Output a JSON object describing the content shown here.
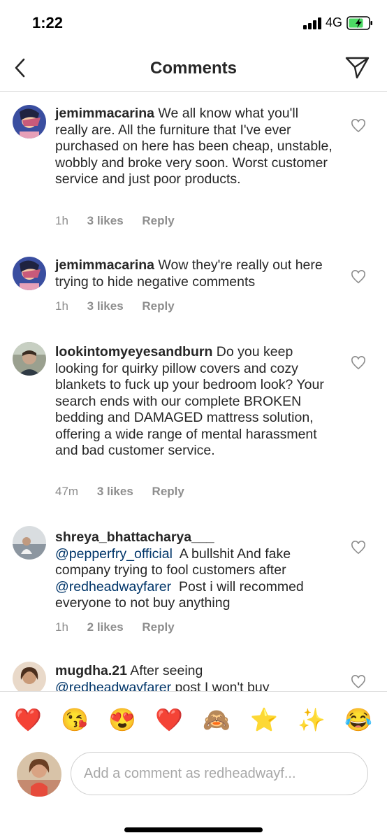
{
  "status_bar": {
    "time": "1:22",
    "network": "4G"
  },
  "header": {
    "title": "Comments"
  },
  "comments": [
    {
      "username": "jemimmacarina",
      "text": "We all know what you'll really are. All the furniture that I've ever purchased on here has been cheap, unstable, wobbly and broke very soon. Worst customer service and just poor products.",
      "time": "1h",
      "likes": "3 likes",
      "reply": "Reply"
    },
    {
      "username": "jemimmacarina",
      "text": "Wow they're really out here trying to hide negative comments",
      "time": "1h",
      "likes": "3 likes",
      "reply": "Reply"
    },
    {
      "username": "lookintomyeyesandburn",
      "text": "Do you keep looking for quirky pillow covers and cozy blankets to fuck up your bedroom look? Your search ends with our complete BROKEN bedding and DAMAGED mattress solution, offering a wide range of mental harassment and bad customer service.",
      "time": "47m",
      "likes": "3 likes",
      "reply": "Reply"
    },
    {
      "username": "shreya_bhattacharya___",
      "mention1": "@pepperfry_official",
      "text_a": "  A bullshit And fake company trying to fool customers after ",
      "mention2": "@redheadwayfarer",
      "text_b": "  Post i will recommed everyone to not buy anything",
      "time": "1h",
      "likes": "2 likes",
      "reply": "Reply"
    },
    {
      "username": "mugdha.21",
      "text_a": "After seeing ",
      "mention": "@redheadwayfarer",
      "text_b": " post I won't buy"
    }
  ],
  "emoji_bar": [
    "❤️",
    "😘",
    "😍",
    "❤️",
    "🙈",
    "⭐",
    "✨",
    "😂"
  ],
  "composer": {
    "placeholder": "Add a comment as redheadwayf..."
  }
}
